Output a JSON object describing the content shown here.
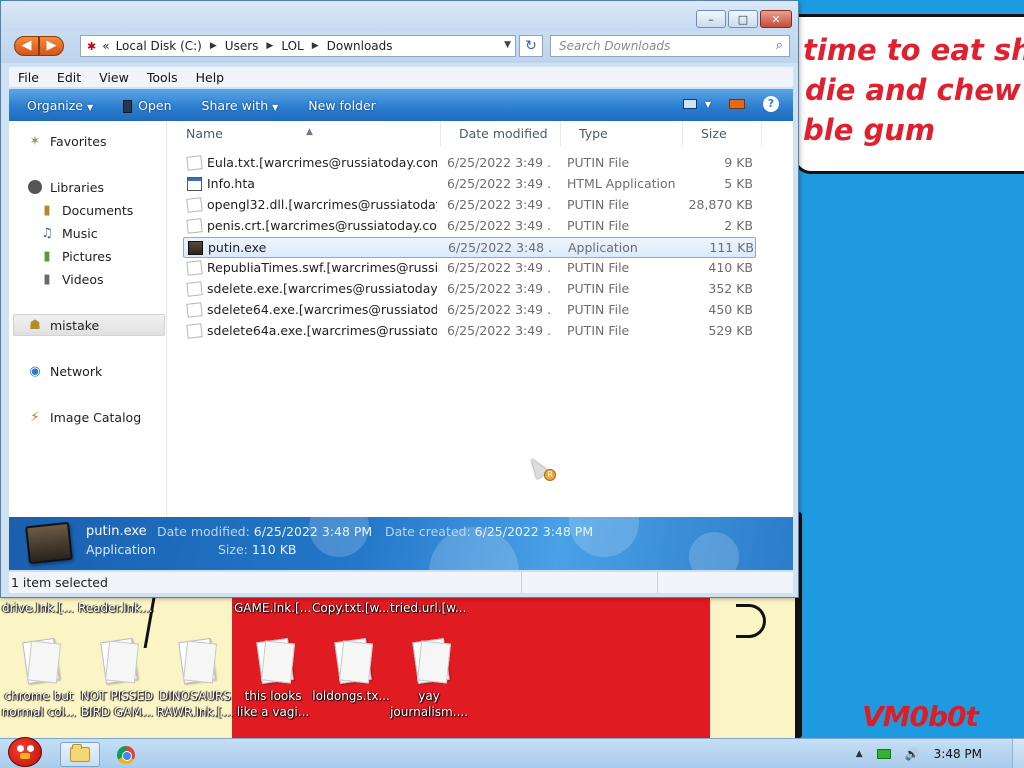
{
  "window": {
    "nav_back": "◀",
    "nav_forward": "▶",
    "minimize_glyph": "–",
    "maximize_glyph": "□",
    "close_glyph": "✕"
  },
  "address": {
    "separator": "«",
    "crumbs": [
      "Local Disk (C:)",
      "Users",
      "LOL",
      "Downloads"
    ],
    "search_placeholder": "Search Downloads"
  },
  "menu": [
    "File",
    "Edit",
    "View",
    "Tools",
    "Help"
  ],
  "commands": {
    "organize": "Organize",
    "open": "Open",
    "share_with": "Share with",
    "new_folder": "New folder",
    "help": "?"
  },
  "nav": {
    "favorites": "Favorites",
    "libraries": "Libraries",
    "documents": "Documents",
    "music": "Music",
    "pictures": "Pictures",
    "videos": "Videos",
    "homegroup": "mistake",
    "network": "Network",
    "image_catalog": "Image Catalog"
  },
  "columns": {
    "name": "Name",
    "date_modified": "Date modified",
    "type": "Type",
    "size": "Size"
  },
  "files": [
    {
      "name": "Eula.txt.[warcrimes@russiatoday.com...",
      "date": "6/25/2022 3:49 ...",
      "type": "PUTIN File",
      "size": "9 KB",
      "icon": "doc"
    },
    {
      "name": "Info.hta",
      "date": "6/25/2022 3:49 ...",
      "type": "HTML Application",
      "size": "5 KB",
      "icon": "hta"
    },
    {
      "name": "opengl32.dll.[warcrimes@russiatoday...",
      "date": "6/25/2022 3:49 ...",
      "type": "PUTIN File",
      "size": "28,870 KB",
      "icon": "doc"
    },
    {
      "name": "penis.crt.[warcrimes@russiatoday.co...",
      "date": "6/25/2022 3:49 ...",
      "type": "PUTIN File",
      "size": "2 KB",
      "icon": "doc"
    },
    {
      "name": "putin.exe",
      "date": "6/25/2022 3:48 ...",
      "type": "Application",
      "size": "111 KB",
      "icon": "exe",
      "selected": true
    },
    {
      "name": "RepubliaTimes.swf.[warcrimes@russi...",
      "date": "6/25/2022 3:49 ...",
      "type": "PUTIN File",
      "size": "410 KB",
      "icon": "doc"
    },
    {
      "name": "sdelete.exe.[warcrimes@russiatoday....",
      "date": "6/25/2022 3:49 ...",
      "type": "PUTIN File",
      "size": "352 KB",
      "icon": "doc"
    },
    {
      "name": "sdelete64.exe.[warcrimes@russiatod...",
      "date": "6/25/2022 3:49 ...",
      "type": "PUTIN File",
      "size": "450 KB",
      "icon": "doc"
    },
    {
      "name": "sdelete64a.exe.[warcrimes@russiato...",
      "date": "6/25/2022 3:49 ...",
      "type": "PUTIN File",
      "size": "529 KB",
      "icon": "doc"
    }
  ],
  "details": {
    "name": "putin.exe",
    "type": "Application",
    "date_modified_label": "Date modified:",
    "date_modified": "6/25/2022 3:48 PM",
    "date_created_label": "Date created:",
    "date_created": "6/25/2022 3:48 PM",
    "size_label": "Size:",
    "size": "110 KB"
  },
  "status": "1 item selected",
  "wallpaper": {
    "speech_lines": [
      "time to eat shit",
      "die and chew",
      "ble gum"
    ],
    "brand": "VM0b0t",
    "brand_color": "#e11b22",
    "bg_color": "#1e9be0"
  },
  "desktop": {
    "top_labels": [
      "drive.lnk.[...",
      "Reader.lnk....",
      "GAME.lnk.[...",
      "Copy.txt.[w...",
      "tried.url.[w..."
    ],
    "icons": [
      {
        "line1": "chrome but",
        "line2": "normal col..."
      },
      {
        "line1": "NOT PISSED",
        "line2": "BIRD GAM..."
      },
      {
        "line1": "DINOSAURS",
        "line2": "RAWR.lnk.[..."
      },
      {
        "line1": "this looks",
        "line2": "like a vagi..."
      },
      {
        "line1": "loldongs.tx...",
        "line2": ""
      },
      {
        "line1": "yay",
        "line2": "journalism...."
      }
    ]
  },
  "taskbar": {
    "clock": "3:48 PM",
    "tray_arrow": "▲",
    "volume_icon": "🔊"
  }
}
